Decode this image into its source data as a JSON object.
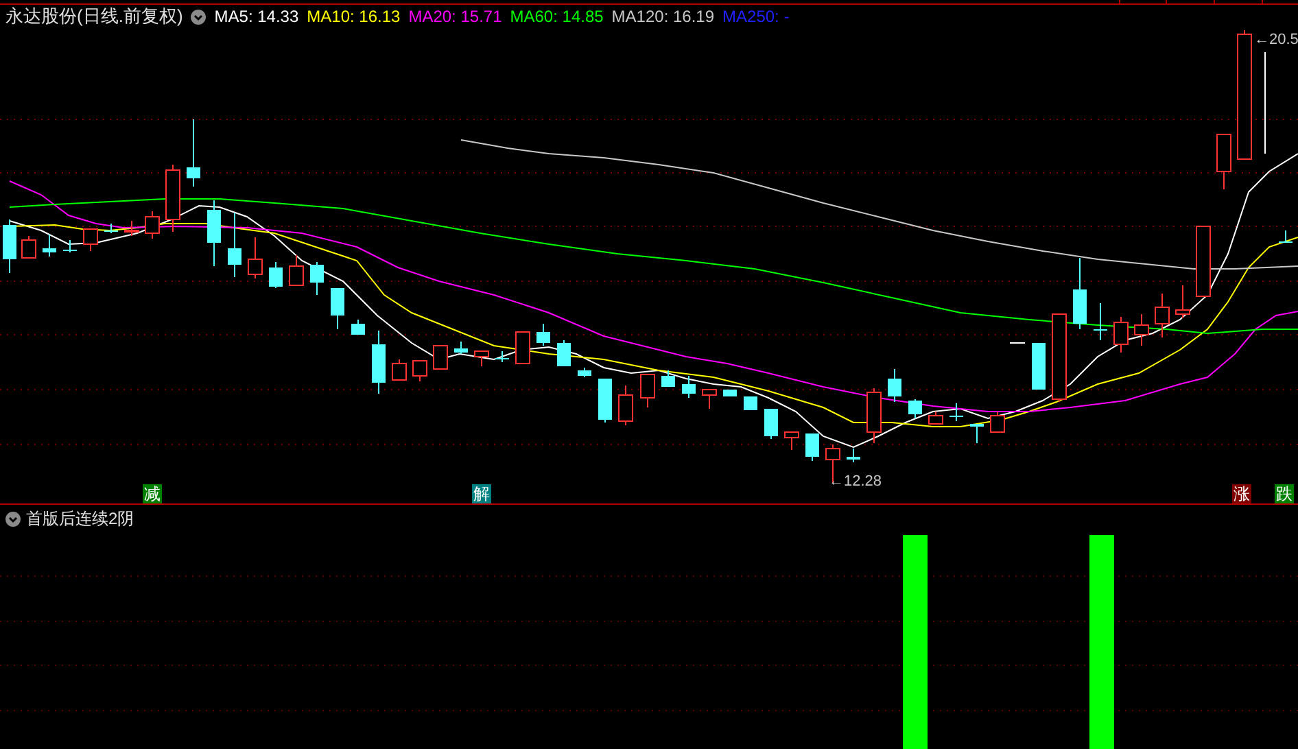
{
  "header": {
    "title": "永达股份(日线.前复权)",
    "legend": [
      {
        "label": "MA5: 14.33",
        "color": "#ffffff"
      },
      {
        "label": "MA10: 16.13",
        "color": "#ffff00"
      },
      {
        "label": "MA20: 15.71",
        "color": "#ff00ff"
      },
      {
        "label": "MA60: 14.85",
        "color": "#00ff00"
      },
      {
        "label": "MA120: 16.19",
        "color": "#c8c8c8"
      },
      {
        "label": "MA250: -",
        "color": "#2020ff"
      }
    ]
  },
  "price_labels": [
    {
      "text": "←20.5",
      "kind": "high"
    },
    {
      "text": "←12.28",
      "kind": "low"
    }
  ],
  "signals": [
    {
      "label": "减",
      "color": "#008000"
    },
    {
      "label": "解",
      "color": "#008080"
    },
    {
      "label": "涨",
      "color": "#800000"
    },
    {
      "label": "跌",
      "color": "#008000"
    }
  ],
  "indicator": {
    "title": "首版后连续2阴"
  }
}
